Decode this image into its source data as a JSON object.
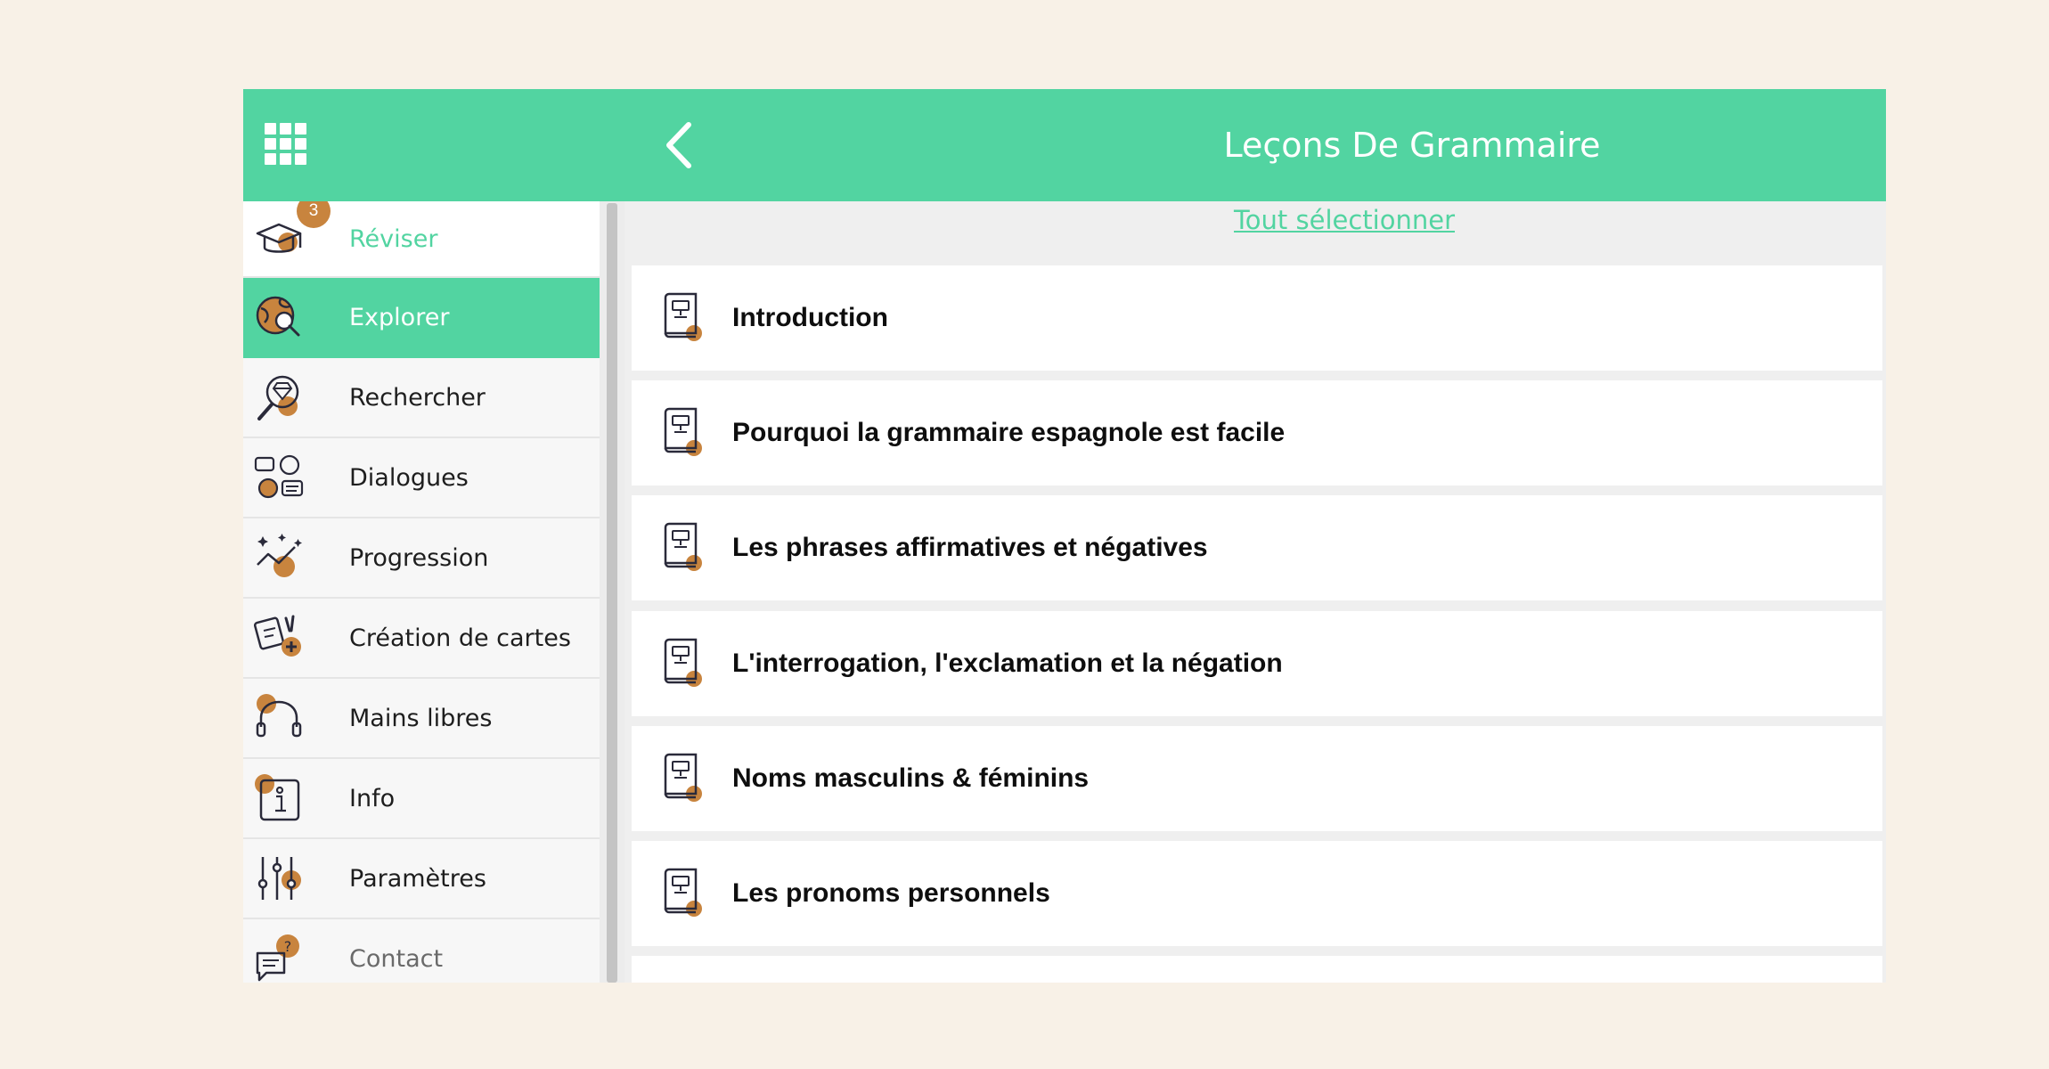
{
  "header": {
    "title": "Leçons De Grammaire",
    "menu_icon": "grid-menu-icon",
    "back_icon": "chevron-left-icon"
  },
  "colors": {
    "accent": "#52d4a1",
    "badge": "#c8843e",
    "background": "#f8f1e7"
  },
  "sidebar": {
    "badge_count": "3",
    "items": [
      {
        "label": "Réviser",
        "icon": "graduation-cap-icon"
      },
      {
        "label": "Explorer",
        "icon": "globe-search-icon",
        "active": true
      },
      {
        "label": "Rechercher",
        "icon": "diamond-magnifier-icon"
      },
      {
        "label": "Dialogues",
        "icon": "dialogue-faces-icon"
      },
      {
        "label": "Progression",
        "icon": "progress-chart-icon"
      },
      {
        "label": "Création de cartes",
        "icon": "card-create-icon"
      },
      {
        "label": "Mains libres",
        "icon": "headphones-icon"
      },
      {
        "label": "Info",
        "icon": "info-icon"
      },
      {
        "label": "Paramètres",
        "icon": "sliders-icon"
      },
      {
        "label": "Contact",
        "icon": "chat-question-icon"
      }
    ]
  },
  "main": {
    "select_all": "Tout sélectionner",
    "lessons": [
      {
        "title": "Introduction",
        "icon": "book-icon"
      },
      {
        "title": "Pourquoi la grammaire espagnole est facile",
        "icon": "book-icon"
      },
      {
        "title": "Les phrases affirmatives et négatives",
        "icon": "book-icon"
      },
      {
        "title": "L'interrogation, l'exclamation et la négation",
        "icon": "book-icon"
      },
      {
        "title": "Noms masculins & féminins",
        "icon": "book-icon"
      },
      {
        "title": "Les pronoms personnels",
        "icon": "book-icon"
      }
    ]
  }
}
